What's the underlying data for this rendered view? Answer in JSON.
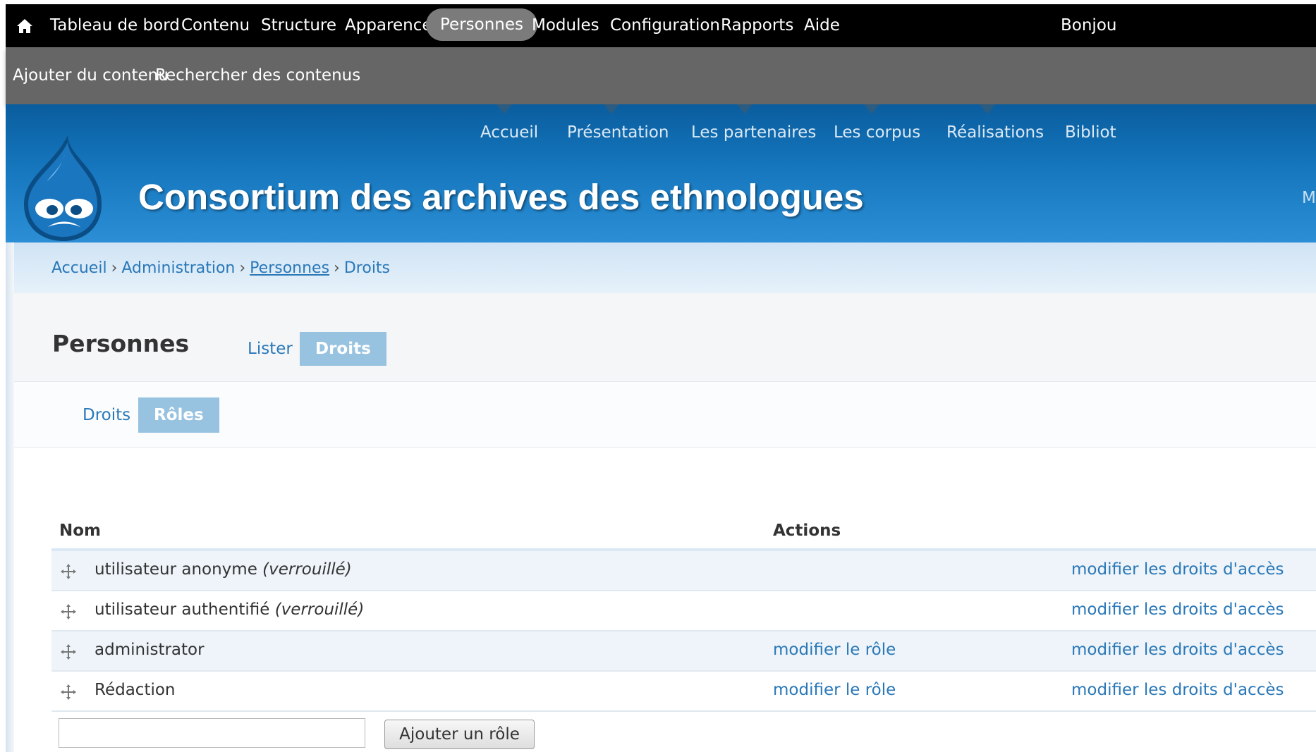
{
  "toolbar": {
    "home_icon": "home-icon",
    "items": [
      {
        "label": "Tableau de bord"
      },
      {
        "label": "Contenu"
      },
      {
        "label": "Structure"
      },
      {
        "label": "Apparence"
      },
      {
        "label": "Personnes",
        "active": true
      },
      {
        "label": "Modules"
      },
      {
        "label": "Configuration"
      },
      {
        "label": "Rapports"
      },
      {
        "label": "Aide"
      }
    ],
    "greeting": "Bonjou"
  },
  "shortcuts": [
    {
      "label": "Ajouter du contenu"
    },
    {
      "label": "Rechercher des contenus"
    }
  ],
  "header": {
    "nav": [
      {
        "label": "Accueil"
      },
      {
        "label": "Présentation"
      },
      {
        "label": "Les partenaires"
      },
      {
        "label": "Les corpus"
      },
      {
        "label": "Réalisations"
      },
      {
        "label": "Bibliot"
      }
    ],
    "site_name": "Consortium des archives des ethnologues",
    "edge_text": "M",
    "logo": "drupal-drop-logo",
    "colors": {
      "header_top": "#0a5d9e",
      "header_bottom": "#2c8fd6"
    }
  },
  "breadcrumb": {
    "items": [
      "Accueil",
      "Administration",
      "Personnes",
      "Droits"
    ],
    "separator": "›"
  },
  "page": {
    "title": "Personnes",
    "primary_tabs": [
      {
        "label": "Lister",
        "active": false
      },
      {
        "label": "Droits",
        "active": true
      }
    ],
    "secondary_tabs": [
      {
        "label": "Droits",
        "active": false
      },
      {
        "label": "Rôles",
        "active": true
      }
    ]
  },
  "table": {
    "headers": {
      "name": "Nom",
      "actions": "Actions"
    },
    "rows": [
      {
        "name": "utilisateur anonyme",
        "note": "(verrouillé)",
        "edit": "",
        "perm": "modifier les droits d'accès"
      },
      {
        "name": "utilisateur authentifié",
        "note": "(verrouillé)",
        "edit": "",
        "perm": "modifier les droits d'accès"
      },
      {
        "name": "administrator",
        "note": "",
        "edit": "modifier le rôle",
        "perm": "modifier les droits d'accès"
      },
      {
        "name": "Rédaction",
        "note": "",
        "edit": "modifier le rôle",
        "perm": "modifier les droits d'accès"
      }
    ],
    "drag_icon": "drag-handle-icon",
    "new_role_value": "",
    "add_button": "Ajouter un rôle"
  },
  "colors": {
    "link": "#2a78b8",
    "active_tab": "#97c2e0",
    "toolbar_active": "#7b7b7b"
  }
}
